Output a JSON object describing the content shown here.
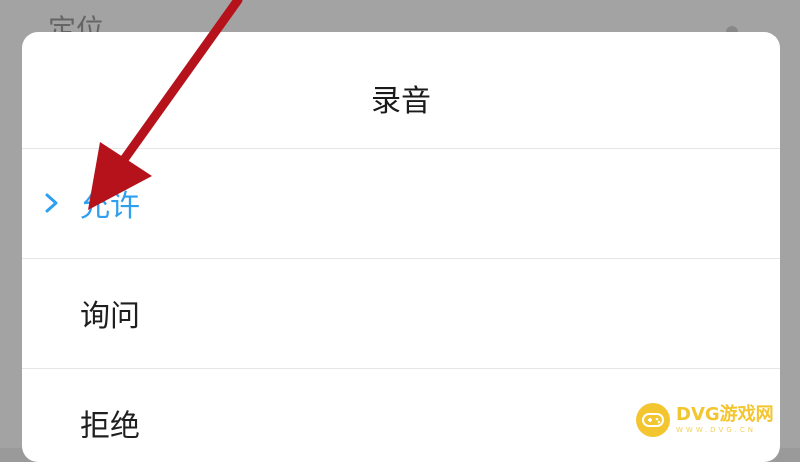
{
  "background": {
    "partial_label": "定位"
  },
  "dialog": {
    "title": "录音",
    "options": [
      {
        "label": "允许",
        "selected": true
      },
      {
        "label": "询问",
        "selected": false
      },
      {
        "label": "拒绝",
        "selected": false
      }
    ]
  },
  "colors": {
    "accent": "#2f9ff0",
    "arrow": "#b5121b",
    "watermark": "#f3c52f"
  },
  "icons": {
    "selected": "chevron-right-icon",
    "annotation": "red-arrow-icon",
    "watermark": "gamepad-icon"
  },
  "watermark": {
    "brand": "DVG游戏网",
    "url": "WWW.DVG.CN"
  }
}
